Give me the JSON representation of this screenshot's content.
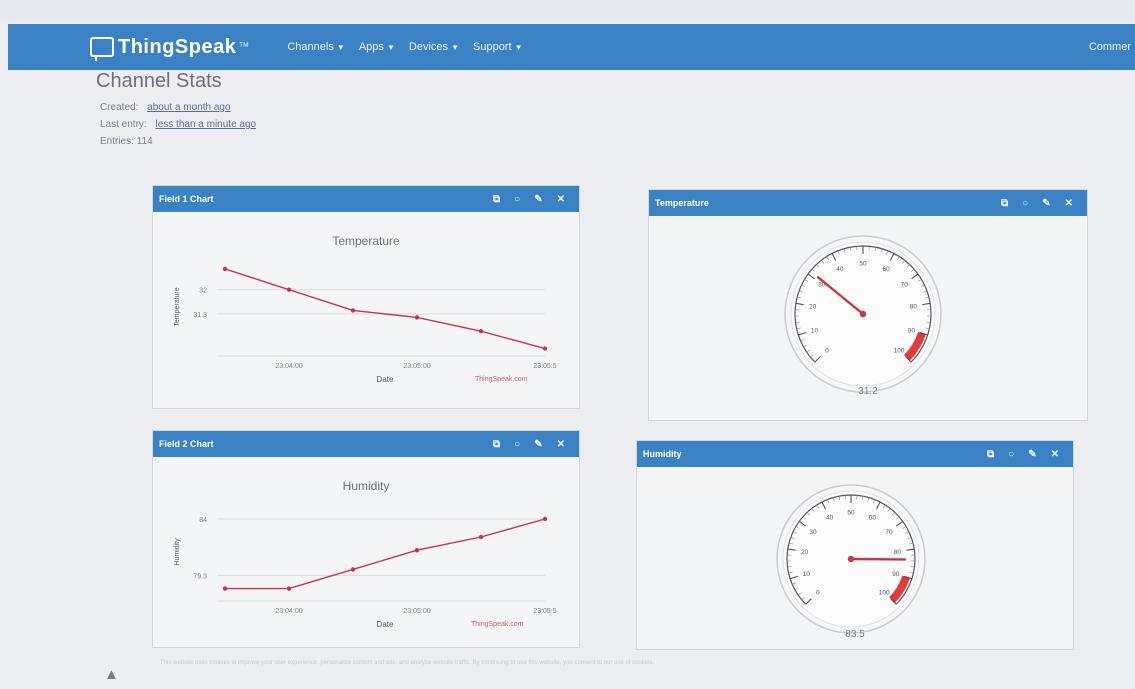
{
  "navbar": {
    "brand": "ThingSpeak",
    "brand_tm": "™",
    "menu": [
      "Channels",
      "Apps",
      "Devices",
      "Support"
    ],
    "right": "Commer"
  },
  "page": {
    "title": "Channel Stats",
    "created_label": "Created:",
    "created_value": "about a month ago",
    "last_entry_label": "Last entry:",
    "last_entry_value": "less than a minute ago",
    "entries_label": "Entries:",
    "entries_value": "114"
  },
  "panels": {
    "field1": {
      "header": "Field 1 Chart"
    },
    "temperature": {
      "header": "Temperature",
      "value": "31.2"
    },
    "field2": {
      "header": "Field 2 Chart"
    },
    "humidity": {
      "header": "Humidity",
      "value": "83.5"
    }
  },
  "icons": [
    "external-link-icon",
    "comment-icon",
    "pencil-icon",
    "close-icon"
  ],
  "colors": {
    "nav": "#3b82c4",
    "series": "#c8344f",
    "gauge_red": "#e03a3a"
  },
  "chart_data": [
    {
      "type": "line",
      "title": "Temperature",
      "xlabel": "Date",
      "ylabel": "Temperature",
      "x": [
        "",
        "23:04:00",
        "",
        "23:05:00",
        "",
        "23:05:5"
      ],
      "values": [
        32.6,
        32.0,
        31.4,
        31.2,
        30.8,
        30.3
      ],
      "yticks": [
        32,
        31.3
      ],
      "ylim": [
        30.2,
        32.8
      ],
      "legend": "ThingSpeak.com"
    },
    {
      "type": "line",
      "title": "Humidity",
      "xlabel": "Date",
      "ylabel": "Humidity",
      "x": [
        "",
        "23:04:00",
        "",
        "23:05:00",
        "",
        "23:05:5"
      ],
      "values": [
        78.2,
        78.2,
        79.8,
        81.4,
        82.5,
        84.0
      ],
      "yticks": [
        84,
        79.3
      ],
      "ylim": [
        77.5,
        85
      ],
      "legend": "ThingSpeak.com"
    },
    {
      "type": "gauge",
      "title": "Temperature",
      "value": 31.2,
      "min": 0,
      "max": 100,
      "ticks": [
        "0",
        "10",
        "20",
        "30",
        "40",
        "50",
        "60",
        "70",
        "80",
        "90",
        "100"
      ]
    },
    {
      "type": "gauge",
      "title": "Humidity",
      "value": 83.5,
      "min": 0,
      "max": 100,
      "ticks": [
        "0",
        "10",
        "20",
        "30",
        "40",
        "50",
        "60",
        "70",
        "80",
        "90",
        "100"
      ]
    }
  ],
  "footer": {
    "text": "This website uses cookies to improve your user experience, personalize content and ads, and analyze website traffic. By continuing to use this website, you consent to our use of cookies."
  }
}
